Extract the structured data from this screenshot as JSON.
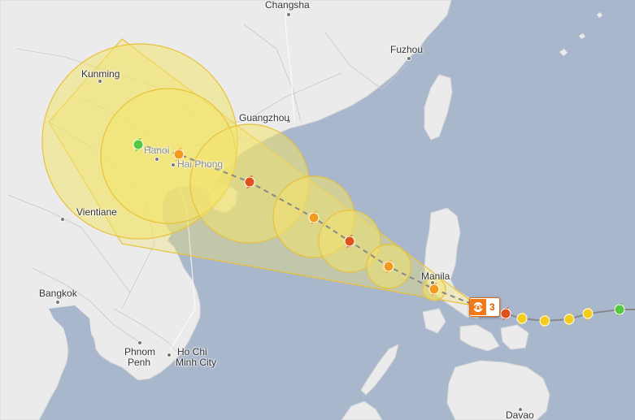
{
  "map": {
    "colors": {
      "water": "#a9b7cc",
      "land": "#ebebeb",
      "cone_fill": "#f2e36e",
      "cone_stroke": "#e8c13a",
      "track_line": "#888888",
      "marker_green": "#55c842",
      "marker_yellow": "#f5cc1a",
      "marker_orange": "#f29a1e",
      "marker_red": "#e0521c"
    }
  },
  "cities": [
    {
      "name": "Changsha"
    },
    {
      "name": "Fuzhou"
    },
    {
      "name": "Kunming"
    },
    {
      "name": "Guangzhou"
    },
    {
      "name": "Hanoi"
    },
    {
      "name": "Hai Phong"
    },
    {
      "name": "Vientiane"
    },
    {
      "name": "Manila"
    },
    {
      "name": "Bangkok"
    },
    {
      "name": "Phnom"
    },
    {
      "name": "Penh"
    },
    {
      "name": "Ho Chi"
    },
    {
      "name": "Minh City"
    },
    {
      "name": "Davao"
    }
  ],
  "storm": {
    "category": "3",
    "icon": "hurricane-icon",
    "track": [
      {
        "intensity": "green"
      },
      {
        "intensity": "yellow"
      },
      {
        "intensity": "yellow"
      },
      {
        "intensity": "yellow"
      },
      {
        "intensity": "yellow"
      },
      {
        "intensity": "red"
      },
      {
        "intensity": "orange"
      },
      {
        "intensity": "orange"
      },
      {
        "intensity": "red"
      },
      {
        "intensity": "red"
      },
      {
        "intensity": "red"
      },
      {
        "intensity": "orange"
      },
      {
        "intensity": "green"
      }
    ]
  }
}
